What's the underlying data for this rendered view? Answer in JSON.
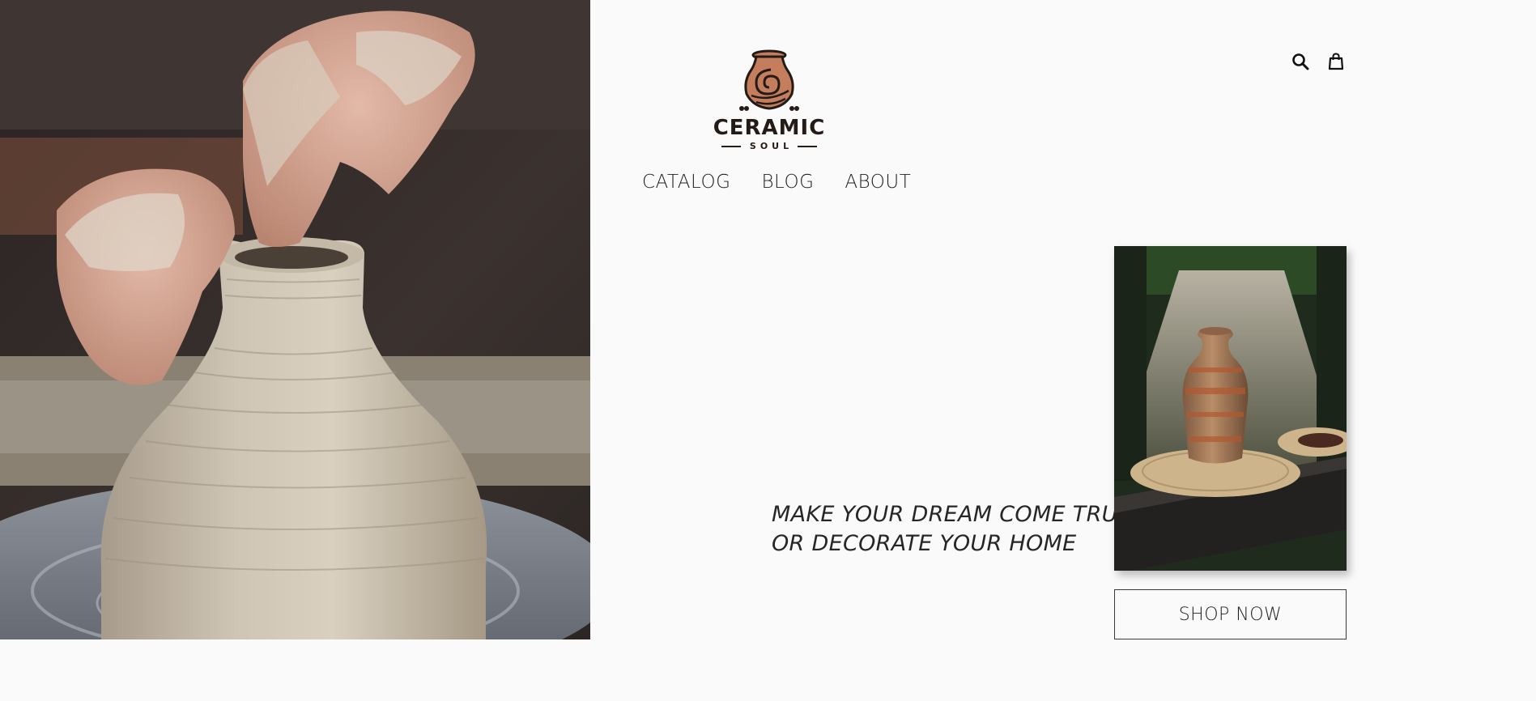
{
  "brand": {
    "name": "CERAMIC",
    "tagline_small": "SOUL",
    "logo_icon": "pot-spiral-icon"
  },
  "header": {
    "icons": [
      "search-icon",
      "shopping-bag-icon"
    ]
  },
  "nav": {
    "items": [
      {
        "label": "CATALOG"
      },
      {
        "label": "BLOG"
      },
      {
        "label": "ABOUT"
      }
    ]
  },
  "hero": {
    "tagline_line1": "MAKE YOUR DREAM COME TRUE",
    "tagline_line2": "OR DECORATE YOUR HOME",
    "cta_label": "SHOP NOW"
  },
  "colors": {
    "background": "#fafafa",
    "text": "#1f1f1f",
    "logo_terracotta": "#c47e5e",
    "logo_dark": "#241a16"
  }
}
